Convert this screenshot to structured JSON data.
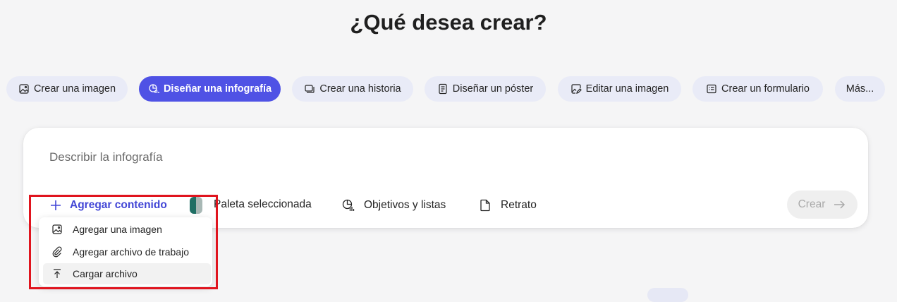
{
  "title": "¿Qué desea crear?",
  "tabs": [
    {
      "label": "Crear una imagen",
      "icon": "image-icon",
      "active": false
    },
    {
      "label": "Diseñar una infografía",
      "icon": "infographic-icon",
      "active": true
    },
    {
      "label": "Crear una historia",
      "icon": "story-icon",
      "active": false
    },
    {
      "label": "Diseñar un póster",
      "icon": "poster-icon",
      "active": false
    },
    {
      "label": "Editar una imagen",
      "icon": "edit-image-icon",
      "active": false
    },
    {
      "label": "Crear un formulario",
      "icon": "form-icon",
      "active": false
    },
    {
      "label": "Más...",
      "icon": "",
      "active": false
    }
  ],
  "composer": {
    "placeholder": "Describir la infografía",
    "add_content_label": "Agregar contenido",
    "palette_label": "Paleta seleccionada",
    "palette_colors": [
      "#1f6f64",
      "#a8b8b5"
    ],
    "goals_label": "Objetivos y listas",
    "orientation_label": "Retrato",
    "create_label": "Crear"
  },
  "dropdown": {
    "items": [
      {
        "label": "Agregar una imagen",
        "icon": "image-icon"
      },
      {
        "label": "Agregar archivo de trabajo",
        "icon": "paperclip-icon"
      },
      {
        "label": "Cargar archivo",
        "icon": "upload-icon"
      }
    ]
  },
  "colors": {
    "accent": "#4f52e5",
    "highlight_border": "#e0141e"
  }
}
